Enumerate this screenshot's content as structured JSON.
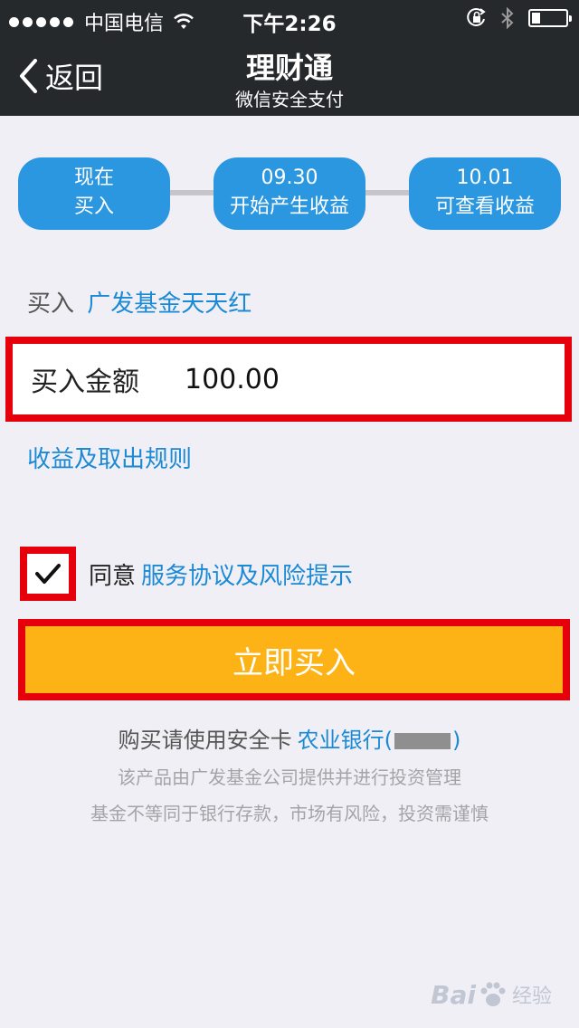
{
  "status_bar": {
    "carrier": "中国电信",
    "time": "下午2:26",
    "battery_level": 0.25,
    "icons": [
      "signal-dots",
      "wifi-icon",
      "rotation-lock-icon",
      "bluetooth-icon",
      "battery-icon"
    ]
  },
  "nav": {
    "back_label": "返回",
    "title": "理财通",
    "subtitle": "微信安全支付"
  },
  "steps": [
    {
      "line1": "现在",
      "line2": "买入"
    },
    {
      "line1": "09.30",
      "line2": "开始产生收益"
    },
    {
      "line1": "10.01",
      "line2": "可查看收益"
    }
  ],
  "product": {
    "prefix": "买入",
    "name": "广发基金天天红"
  },
  "amount": {
    "label": "买入金额",
    "value": "100.00"
  },
  "rules_link": "收益及取出规则",
  "agreement": {
    "checked": true,
    "text": "同意",
    "link": "服务协议及风险提示"
  },
  "buy_button": "立即买入",
  "card": {
    "prefix": "购买请使用安全卡",
    "bank": "农业银行(",
    "suffix": ")"
  },
  "info": [
    "该产品由广发基金公司提供并进行投资管理",
    "基金不等同于银行存款，市场有风险，投资需谨慎"
  ],
  "watermark": {
    "text_left": "Bai",
    "text_right": "经验"
  },
  "colors": {
    "header_bg": "#25292c",
    "page_bg": "#f0eff5",
    "step_blue": "#2b97e0",
    "link_blue": "#1a8ad6",
    "button_orange": "#fdb316",
    "highlight_red": "#e5000b"
  }
}
